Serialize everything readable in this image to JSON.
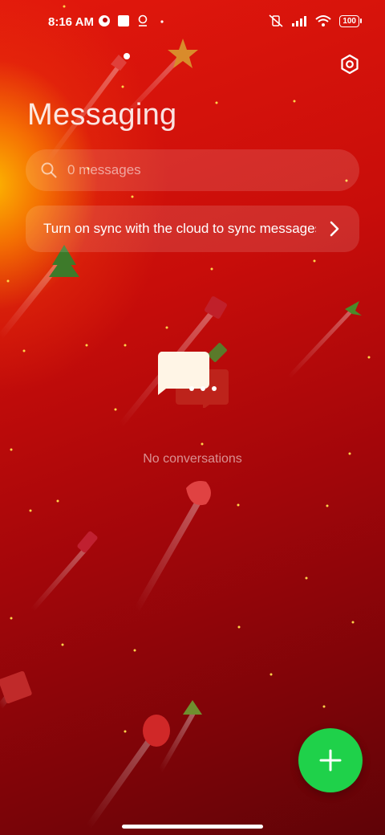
{
  "status_bar": {
    "time": "8:16 AM",
    "battery": "100"
  },
  "header": {
    "title": "Messaging"
  },
  "search": {
    "placeholder": "0 messages"
  },
  "sync_banner": {
    "text": "Turn on sync with the cloud to sync messages"
  },
  "empty_state": {
    "text": "No conversations"
  },
  "icons": {
    "settings": "settings-icon",
    "search": "search-icon",
    "chevron": "chevron-right-icon",
    "compose": "plus-icon",
    "empty": "chat-bubbles-icon"
  },
  "colors": {
    "fab": "#1fd14a",
    "background_start": "#e2180c",
    "background_end": "#5f0307"
  }
}
